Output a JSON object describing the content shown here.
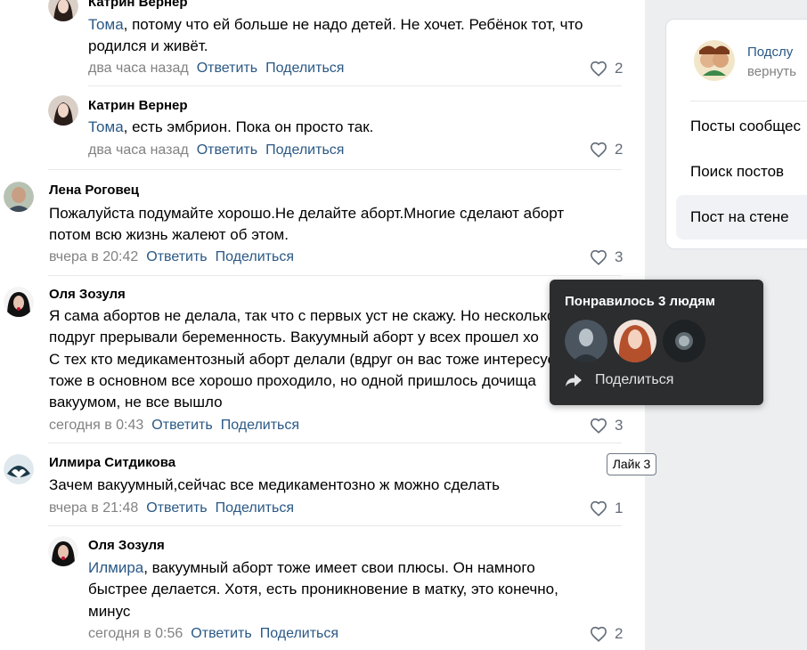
{
  "comments": [
    {
      "author": "Катрин Вернер",
      "mention": "Тома",
      "lines": [
        ", потому что ей больше не надо детей. Не хочет. Ребёнок тот, что",
        "родился и живёт."
      ],
      "time": "два часа назад",
      "reply": "Ответить",
      "share": "Поделиться",
      "likes": "2"
    },
    {
      "author": "Катрин Вернер",
      "mention": "Тома",
      "lines": [
        ", есть эмбрион. Пока он просто так."
      ],
      "time": "два часа назад",
      "reply": "Ответить",
      "share": "Поделиться",
      "likes": "2"
    },
    {
      "author": "Лена Роговец",
      "lines": [
        "Пожалуйста подумайте хорошо.Не делайте аборт.Многие сделают аборт",
        "потом всю жизнь жалеют об этом."
      ],
      "time": "вчера в 20:42",
      "reply": "Ответить",
      "share": "Поделиться",
      "likes": "3"
    },
    {
      "author": "Оля Зозуля",
      "lines": [
        "Я сама абортов не делала, так что с первых уст не скажу. Но несколько",
        "подруг прерывали беременность. Вакуумный аборт у всех прошел хо",
        "С тех кто медикаментозный аборт делали (вдруг он вас тоже интересует)",
        "тоже в основном все хорошо проходило, но одной пришлось дочища",
        "вакуумом, не все вышло"
      ],
      "time": "сегодня в 0:43",
      "reply": "Ответить",
      "share": "Поделиться",
      "likes": "3"
    },
    {
      "author": "Илмира Ситдикова",
      "lines": [
        "Зачем вакуумный,сейчас все медикаментозно ж можно сделать"
      ],
      "time": "вчера в 21:48",
      "reply": "Ответить",
      "share": "Поделиться",
      "likes": "1"
    },
    {
      "author": "Оля Зозуля",
      "mention": "Илмира",
      "lines": [
        ", вакуумный аборт тоже имеет свои плюсы. Он намного",
        "быстрее делается. Хотя, есть проникновение в матку, это конечно,",
        "минус"
      ],
      "time": "сегодня в 0:56",
      "reply": "Ответить",
      "share": "Поделиться",
      "likes": "2"
    }
  ],
  "tooltip": {
    "title": "Понравилось 3 людям",
    "share": "Поделиться",
    "like_hint": "Лайк 3"
  },
  "sidebar": {
    "title": "Подслу",
    "subtitle": "вернуть",
    "items": [
      "Посты сообщес",
      "Поиск постов",
      "Пост на стене"
    ]
  },
  "colors": {
    "link": "#2a5885",
    "meta": "#828282",
    "tooltip_bg": "#2c2d2e"
  }
}
